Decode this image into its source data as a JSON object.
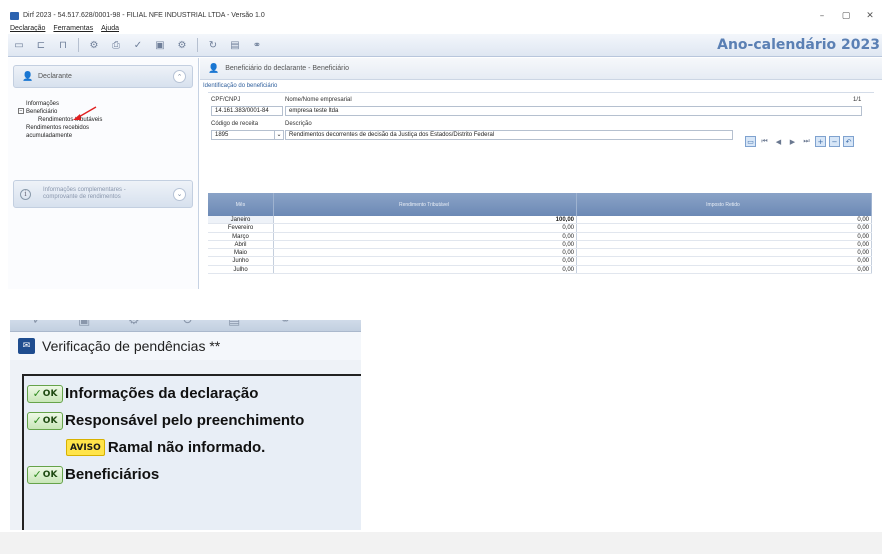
{
  "window": {
    "title": "Dirf 2023 - 54.517.628/0001-98 - FILIAL NFE INDUSTRIAL LTDA - Versão 1.0",
    "controls": [
      "–",
      "▢",
      "✕"
    ]
  },
  "menu": [
    "Declaração",
    "Ferramentas",
    "Ajuda"
  ],
  "toolbar": {
    "icons": [
      "new-file-icon",
      "open-folder-icon",
      "folder-icon",
      "import-icon",
      "print-icon",
      "check-icon",
      "save-icon",
      "export-icon",
      "refresh-icon",
      "clipboard-icon",
      "attach-icon"
    ],
    "year_label": "Ano-calendário 2023"
  },
  "sidebar": {
    "section1": "Declarante",
    "tree": [
      {
        "label": "Informações",
        "level": 0
      },
      {
        "label": "Beneficiário",
        "level": 0,
        "expanded": true
      },
      {
        "label": "Rendimentos tributáveis",
        "level": 1
      },
      {
        "label": "Rendimentos recebidos",
        "level": 0
      },
      {
        "label": "acumuladamente",
        "level": 0
      }
    ],
    "section2_line1": "Informações complementares -",
    "section2_line2": "comprovante de rendimentos"
  },
  "main": {
    "header": "Beneficiário do declarante - Beneficiário",
    "section_title": "Identificação do beneficiário",
    "cpf_label": "CPF/CNPJ",
    "cpf_value": "14.161.383/0001-84",
    "name_label": "Nome/Nome empresarial",
    "name_value": "empresa teste ltda",
    "counter": "1/1",
    "code_label": "Código de receita",
    "code_value": "1895",
    "desc_label": "Descrição",
    "desc_value": "Rendimentos decorrentes de decisão da Justiça dos Estados/Distrito Federal"
  },
  "grid": {
    "columns": [
      "Mês",
      "Rendimento Tributável",
      "Imposto Retido"
    ],
    "rows": [
      {
        "month": "Janeiro",
        "rend": "100,00",
        "imp": "0,00"
      },
      {
        "month": "Fevereiro",
        "rend": "0,00",
        "imp": "0,00"
      },
      {
        "month": "Março",
        "rend": "0,00",
        "imp": "0,00"
      },
      {
        "month": "Abril",
        "rend": "0,00",
        "imp": "0,00"
      },
      {
        "month": "Maio",
        "rend": "0,00",
        "imp": "0,00"
      },
      {
        "month": "Junho",
        "rend": "0,00",
        "imp": "0,00"
      },
      {
        "month": "Julho",
        "rend": "0,00",
        "imp": "0,00"
      }
    ]
  },
  "verification": {
    "title": "Verificação de pendências **",
    "ok_label": "OK",
    "warn_label": "AVISO",
    "items": [
      {
        "type": "ok",
        "text": "Informações da declaração",
        "indent": 0
      },
      {
        "type": "ok",
        "text": "Responsável pelo preenchimento",
        "indent": 0
      },
      {
        "type": "aviso",
        "text": "Ramal não informado.",
        "indent": 1
      },
      {
        "type": "ok",
        "text": "Beneficiários",
        "indent": 0
      }
    ]
  },
  "colors": {
    "accent": "#5b80b4",
    "grid_header": "#6c89b5",
    "ok_green": "#66a34a",
    "warn_yellow": "#ffe44a",
    "arrow_red": "#e02020"
  }
}
